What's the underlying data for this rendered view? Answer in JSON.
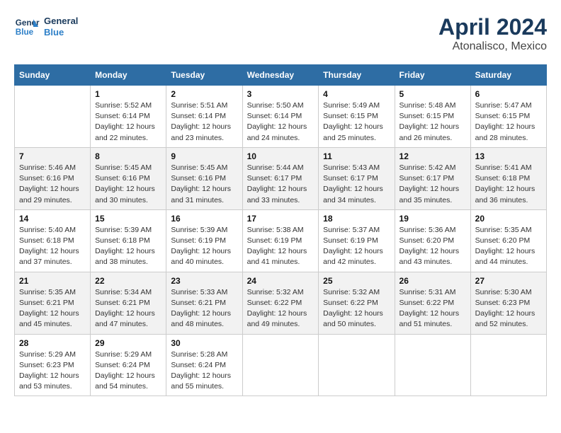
{
  "header": {
    "logo_line1": "General",
    "logo_line2": "Blue",
    "month": "April 2024",
    "location": "Atonalisco, Mexico"
  },
  "weekdays": [
    "Sunday",
    "Monday",
    "Tuesday",
    "Wednesday",
    "Thursday",
    "Friday",
    "Saturday"
  ],
  "weeks": [
    [
      {
        "day": "",
        "info": ""
      },
      {
        "day": "1",
        "info": "Sunrise: 5:52 AM\nSunset: 6:14 PM\nDaylight: 12 hours\nand 22 minutes."
      },
      {
        "day": "2",
        "info": "Sunrise: 5:51 AM\nSunset: 6:14 PM\nDaylight: 12 hours\nand 23 minutes."
      },
      {
        "day": "3",
        "info": "Sunrise: 5:50 AM\nSunset: 6:14 PM\nDaylight: 12 hours\nand 24 minutes."
      },
      {
        "day": "4",
        "info": "Sunrise: 5:49 AM\nSunset: 6:15 PM\nDaylight: 12 hours\nand 25 minutes."
      },
      {
        "day": "5",
        "info": "Sunrise: 5:48 AM\nSunset: 6:15 PM\nDaylight: 12 hours\nand 26 minutes."
      },
      {
        "day": "6",
        "info": "Sunrise: 5:47 AM\nSunset: 6:15 PM\nDaylight: 12 hours\nand 28 minutes."
      }
    ],
    [
      {
        "day": "7",
        "info": "Sunrise: 5:46 AM\nSunset: 6:16 PM\nDaylight: 12 hours\nand 29 minutes."
      },
      {
        "day": "8",
        "info": "Sunrise: 5:45 AM\nSunset: 6:16 PM\nDaylight: 12 hours\nand 30 minutes."
      },
      {
        "day": "9",
        "info": "Sunrise: 5:45 AM\nSunset: 6:16 PM\nDaylight: 12 hours\nand 31 minutes."
      },
      {
        "day": "10",
        "info": "Sunrise: 5:44 AM\nSunset: 6:17 PM\nDaylight: 12 hours\nand 33 minutes."
      },
      {
        "day": "11",
        "info": "Sunrise: 5:43 AM\nSunset: 6:17 PM\nDaylight: 12 hours\nand 34 minutes."
      },
      {
        "day": "12",
        "info": "Sunrise: 5:42 AM\nSunset: 6:17 PM\nDaylight: 12 hours\nand 35 minutes."
      },
      {
        "day": "13",
        "info": "Sunrise: 5:41 AM\nSunset: 6:18 PM\nDaylight: 12 hours\nand 36 minutes."
      }
    ],
    [
      {
        "day": "14",
        "info": "Sunrise: 5:40 AM\nSunset: 6:18 PM\nDaylight: 12 hours\nand 37 minutes."
      },
      {
        "day": "15",
        "info": "Sunrise: 5:39 AM\nSunset: 6:18 PM\nDaylight: 12 hours\nand 38 minutes."
      },
      {
        "day": "16",
        "info": "Sunrise: 5:39 AM\nSunset: 6:19 PM\nDaylight: 12 hours\nand 40 minutes."
      },
      {
        "day": "17",
        "info": "Sunrise: 5:38 AM\nSunset: 6:19 PM\nDaylight: 12 hours\nand 41 minutes."
      },
      {
        "day": "18",
        "info": "Sunrise: 5:37 AM\nSunset: 6:19 PM\nDaylight: 12 hours\nand 42 minutes."
      },
      {
        "day": "19",
        "info": "Sunrise: 5:36 AM\nSunset: 6:20 PM\nDaylight: 12 hours\nand 43 minutes."
      },
      {
        "day": "20",
        "info": "Sunrise: 5:35 AM\nSunset: 6:20 PM\nDaylight: 12 hours\nand 44 minutes."
      }
    ],
    [
      {
        "day": "21",
        "info": "Sunrise: 5:35 AM\nSunset: 6:21 PM\nDaylight: 12 hours\nand 45 minutes."
      },
      {
        "day": "22",
        "info": "Sunrise: 5:34 AM\nSunset: 6:21 PM\nDaylight: 12 hours\nand 47 minutes."
      },
      {
        "day": "23",
        "info": "Sunrise: 5:33 AM\nSunset: 6:21 PM\nDaylight: 12 hours\nand 48 minutes."
      },
      {
        "day": "24",
        "info": "Sunrise: 5:32 AM\nSunset: 6:22 PM\nDaylight: 12 hours\nand 49 minutes."
      },
      {
        "day": "25",
        "info": "Sunrise: 5:32 AM\nSunset: 6:22 PM\nDaylight: 12 hours\nand 50 minutes."
      },
      {
        "day": "26",
        "info": "Sunrise: 5:31 AM\nSunset: 6:22 PM\nDaylight: 12 hours\nand 51 minutes."
      },
      {
        "day": "27",
        "info": "Sunrise: 5:30 AM\nSunset: 6:23 PM\nDaylight: 12 hours\nand 52 minutes."
      }
    ],
    [
      {
        "day": "28",
        "info": "Sunrise: 5:29 AM\nSunset: 6:23 PM\nDaylight: 12 hours\nand 53 minutes."
      },
      {
        "day": "29",
        "info": "Sunrise: 5:29 AM\nSunset: 6:24 PM\nDaylight: 12 hours\nand 54 minutes."
      },
      {
        "day": "30",
        "info": "Sunrise: 5:28 AM\nSunset: 6:24 PM\nDaylight: 12 hours\nand 55 minutes."
      },
      {
        "day": "",
        "info": ""
      },
      {
        "day": "",
        "info": ""
      },
      {
        "day": "",
        "info": ""
      },
      {
        "day": "",
        "info": ""
      }
    ]
  ]
}
